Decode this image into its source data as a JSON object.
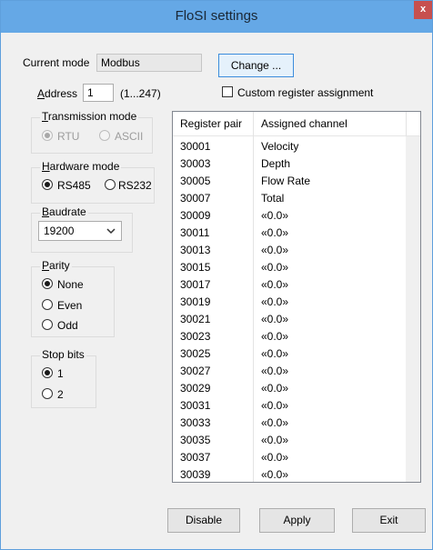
{
  "window": {
    "title": "FloSI settings",
    "close_glyph": "x"
  },
  "mode": {
    "label": "Current mode",
    "value": "Modbus",
    "change_button": "Change ..."
  },
  "address": {
    "label_first": "A",
    "label_rest": "ddress",
    "value": "1",
    "range": "(1...247)"
  },
  "custom_register": {
    "label": "Custom register assignment",
    "checked": false
  },
  "transmission": {
    "legend_first": "T",
    "legend_rest": "ransmission mode",
    "options": [
      {
        "label": "RTU",
        "selected": true
      },
      {
        "label": "ASCII",
        "selected": false
      }
    ],
    "disabled": true
  },
  "hardware": {
    "legend_first": "H",
    "legend_rest": "ardware mode",
    "options": [
      {
        "label": "RS485",
        "selected": true
      },
      {
        "label": "RS232",
        "selected": false
      }
    ]
  },
  "baudrate": {
    "legend_first": "B",
    "legend_rest": "audrate",
    "value": "19200"
  },
  "parity": {
    "legend_first": "P",
    "legend_rest": "arity",
    "options": [
      {
        "label": "None",
        "selected": true
      },
      {
        "label": "Even",
        "selected": false
      },
      {
        "label": "Odd",
        "selected": false
      }
    ]
  },
  "stopbits": {
    "legend": "Stop bits",
    "options": [
      {
        "label": "1",
        "selected": true
      },
      {
        "label": "2",
        "selected": false
      }
    ]
  },
  "table": {
    "headers": [
      "Register pair",
      "Assigned channel"
    ],
    "rows": [
      [
        "30001",
        "Velocity"
      ],
      [
        "30003",
        "Depth"
      ],
      [
        "30005",
        "Flow Rate"
      ],
      [
        "30007",
        "Total"
      ],
      [
        "30009",
        "«0.0»"
      ],
      [
        "30011",
        "«0.0»"
      ],
      [
        "30013",
        "«0.0»"
      ],
      [
        "30015",
        "«0.0»"
      ],
      [
        "30017",
        "«0.0»"
      ],
      [
        "30019",
        "«0.0»"
      ],
      [
        "30021",
        "«0.0»"
      ],
      [
        "30023",
        "«0.0»"
      ],
      [
        "30025",
        "«0.0»"
      ],
      [
        "30027",
        "«0.0»"
      ],
      [
        "30029",
        "«0.0»"
      ],
      [
        "30031",
        "«0.0»"
      ],
      [
        "30033",
        "«0.0»"
      ],
      [
        "30035",
        "«0.0»"
      ],
      [
        "30037",
        "«0.0»"
      ],
      [
        "30039",
        "«0.0»"
      ]
    ]
  },
  "buttons": {
    "disable": "Disable",
    "apply": "Apply",
    "exit": "Exit"
  }
}
